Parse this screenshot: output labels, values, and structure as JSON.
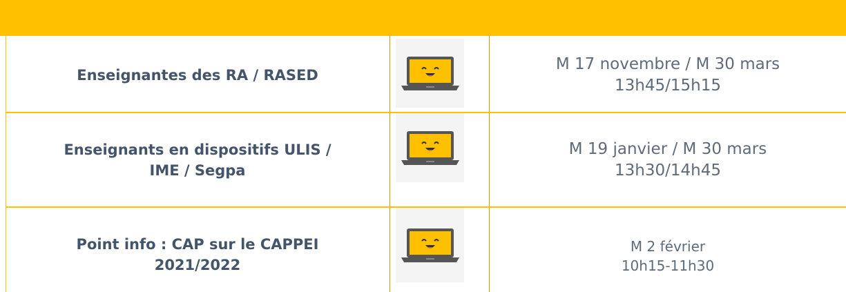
{
  "rows": [
    {
      "label_line1": "Enseignantes des RA / RASED",
      "label_line2": "",
      "icon": "laptop-smile-icon",
      "date_line1": "M 17 novembre / M 30 mars",
      "date_line2": "13h45/15h15"
    },
    {
      "label_line1": "Enseignants en dispositifs ULIS /",
      "label_line2": "IME / Segpa",
      "icon": "laptop-smile-icon",
      "date_line1": "M 19 janvier / M 30 mars",
      "date_line2": "13h30/14h45"
    },
    {
      "label_line1": "Point info : CAP sur le CAPPEI",
      "label_line2": "2021/2022",
      "icon": "laptop-smile-icon",
      "date_line1": "M 2 février",
      "date_line2": "10h15-11h30"
    }
  ],
  "colors": {
    "accent": "#ffc000",
    "label_text": "#44546a",
    "date_text": "#5f6b7a",
    "icon_screen": "#ffc000"
  }
}
